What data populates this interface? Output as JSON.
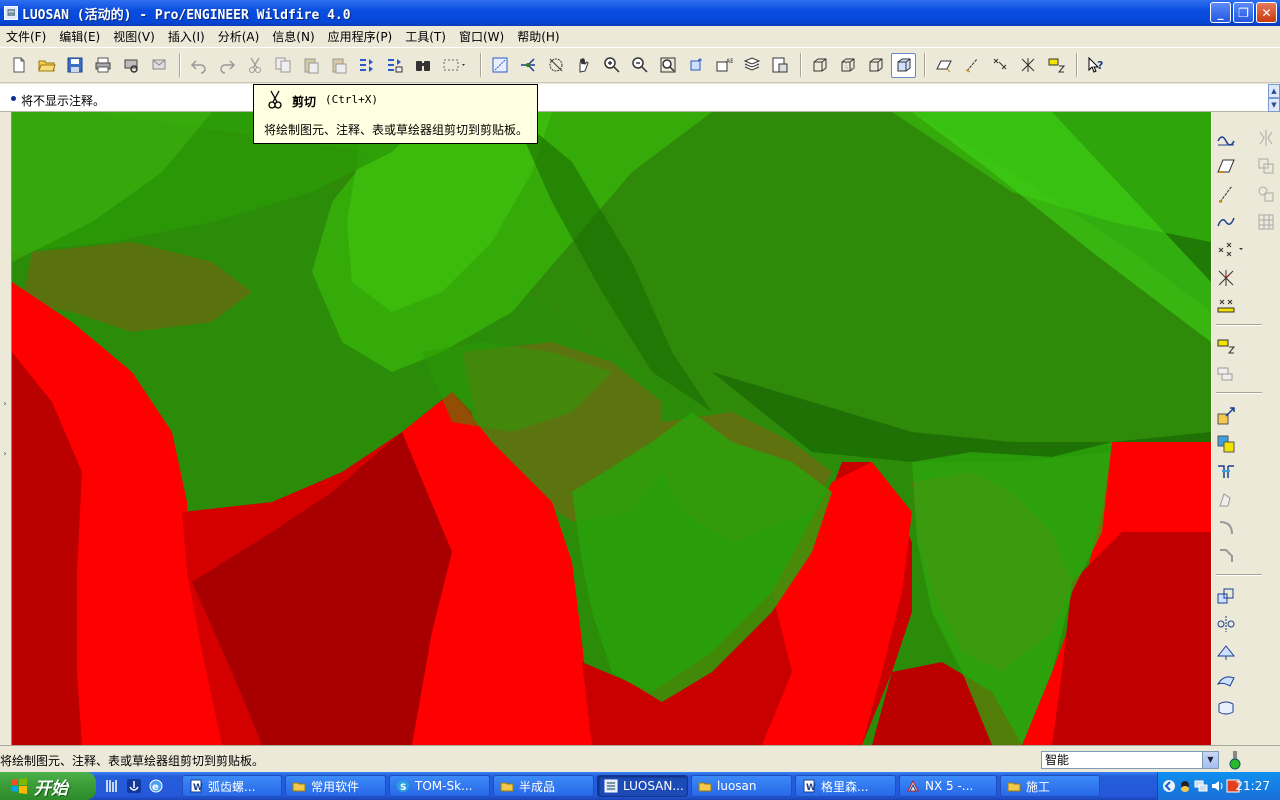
{
  "window": {
    "title": "LUOSAN (活动的) - Pro/ENGINEER Wildfire 4.0",
    "minimize": "_",
    "maximize": "❐",
    "close": "✕"
  },
  "menu": [
    {
      "label": "文件(F)"
    },
    {
      "label": "编辑(E)"
    },
    {
      "label": "视图(V)"
    },
    {
      "label": "插入(I)"
    },
    {
      "label": "分析(A)"
    },
    {
      "label": "信息(N)"
    },
    {
      "label": "应用程序(P)"
    },
    {
      "label": "工具(T)"
    },
    {
      "label": "窗口(W)"
    },
    {
      "label": "帮助(H)"
    }
  ],
  "message_area": {
    "text": "将不显示注释。"
  },
  "tooltip": {
    "title": "剪切",
    "shortcut": "(Ctrl+X)",
    "description": "将绘制图元、注释、表或草绘器组剪切到剪贴板。"
  },
  "status": {
    "text": "将绘制图元、注释、表或草绘器组剪切到剪贴板。",
    "filter_value": "智能"
  },
  "taskbar": {
    "start_label": "开始",
    "tasks": [
      {
        "label": "弧齿螺...",
        "icon": "document-icon",
        "active": false
      },
      {
        "label": "常用软件",
        "icon": "folder-icon",
        "active": false
      },
      {
        "label": "TOM-Sk...",
        "icon": "skype-icon",
        "active": false
      },
      {
        "label": "半成品",
        "icon": "folder-icon",
        "active": false
      },
      {
        "label": "LUOSAN...",
        "icon": "proe-icon",
        "active": true
      },
      {
        "label": "luosan",
        "icon": "folder-icon",
        "active": false
      },
      {
        "label": "格里森...",
        "icon": "document-icon",
        "active": false
      },
      {
        "label": "NX 5 -...",
        "icon": "nx-icon",
        "active": false
      },
      {
        "label": "施工",
        "icon": "folder-icon",
        "active": false
      }
    ],
    "clock": "21:27"
  },
  "colors": {
    "red_surface": "#ff0000",
    "green_surface": "#1fa800",
    "title_blue": "#0a4ee0",
    "tooltip_bg": "#ffffe1"
  }
}
